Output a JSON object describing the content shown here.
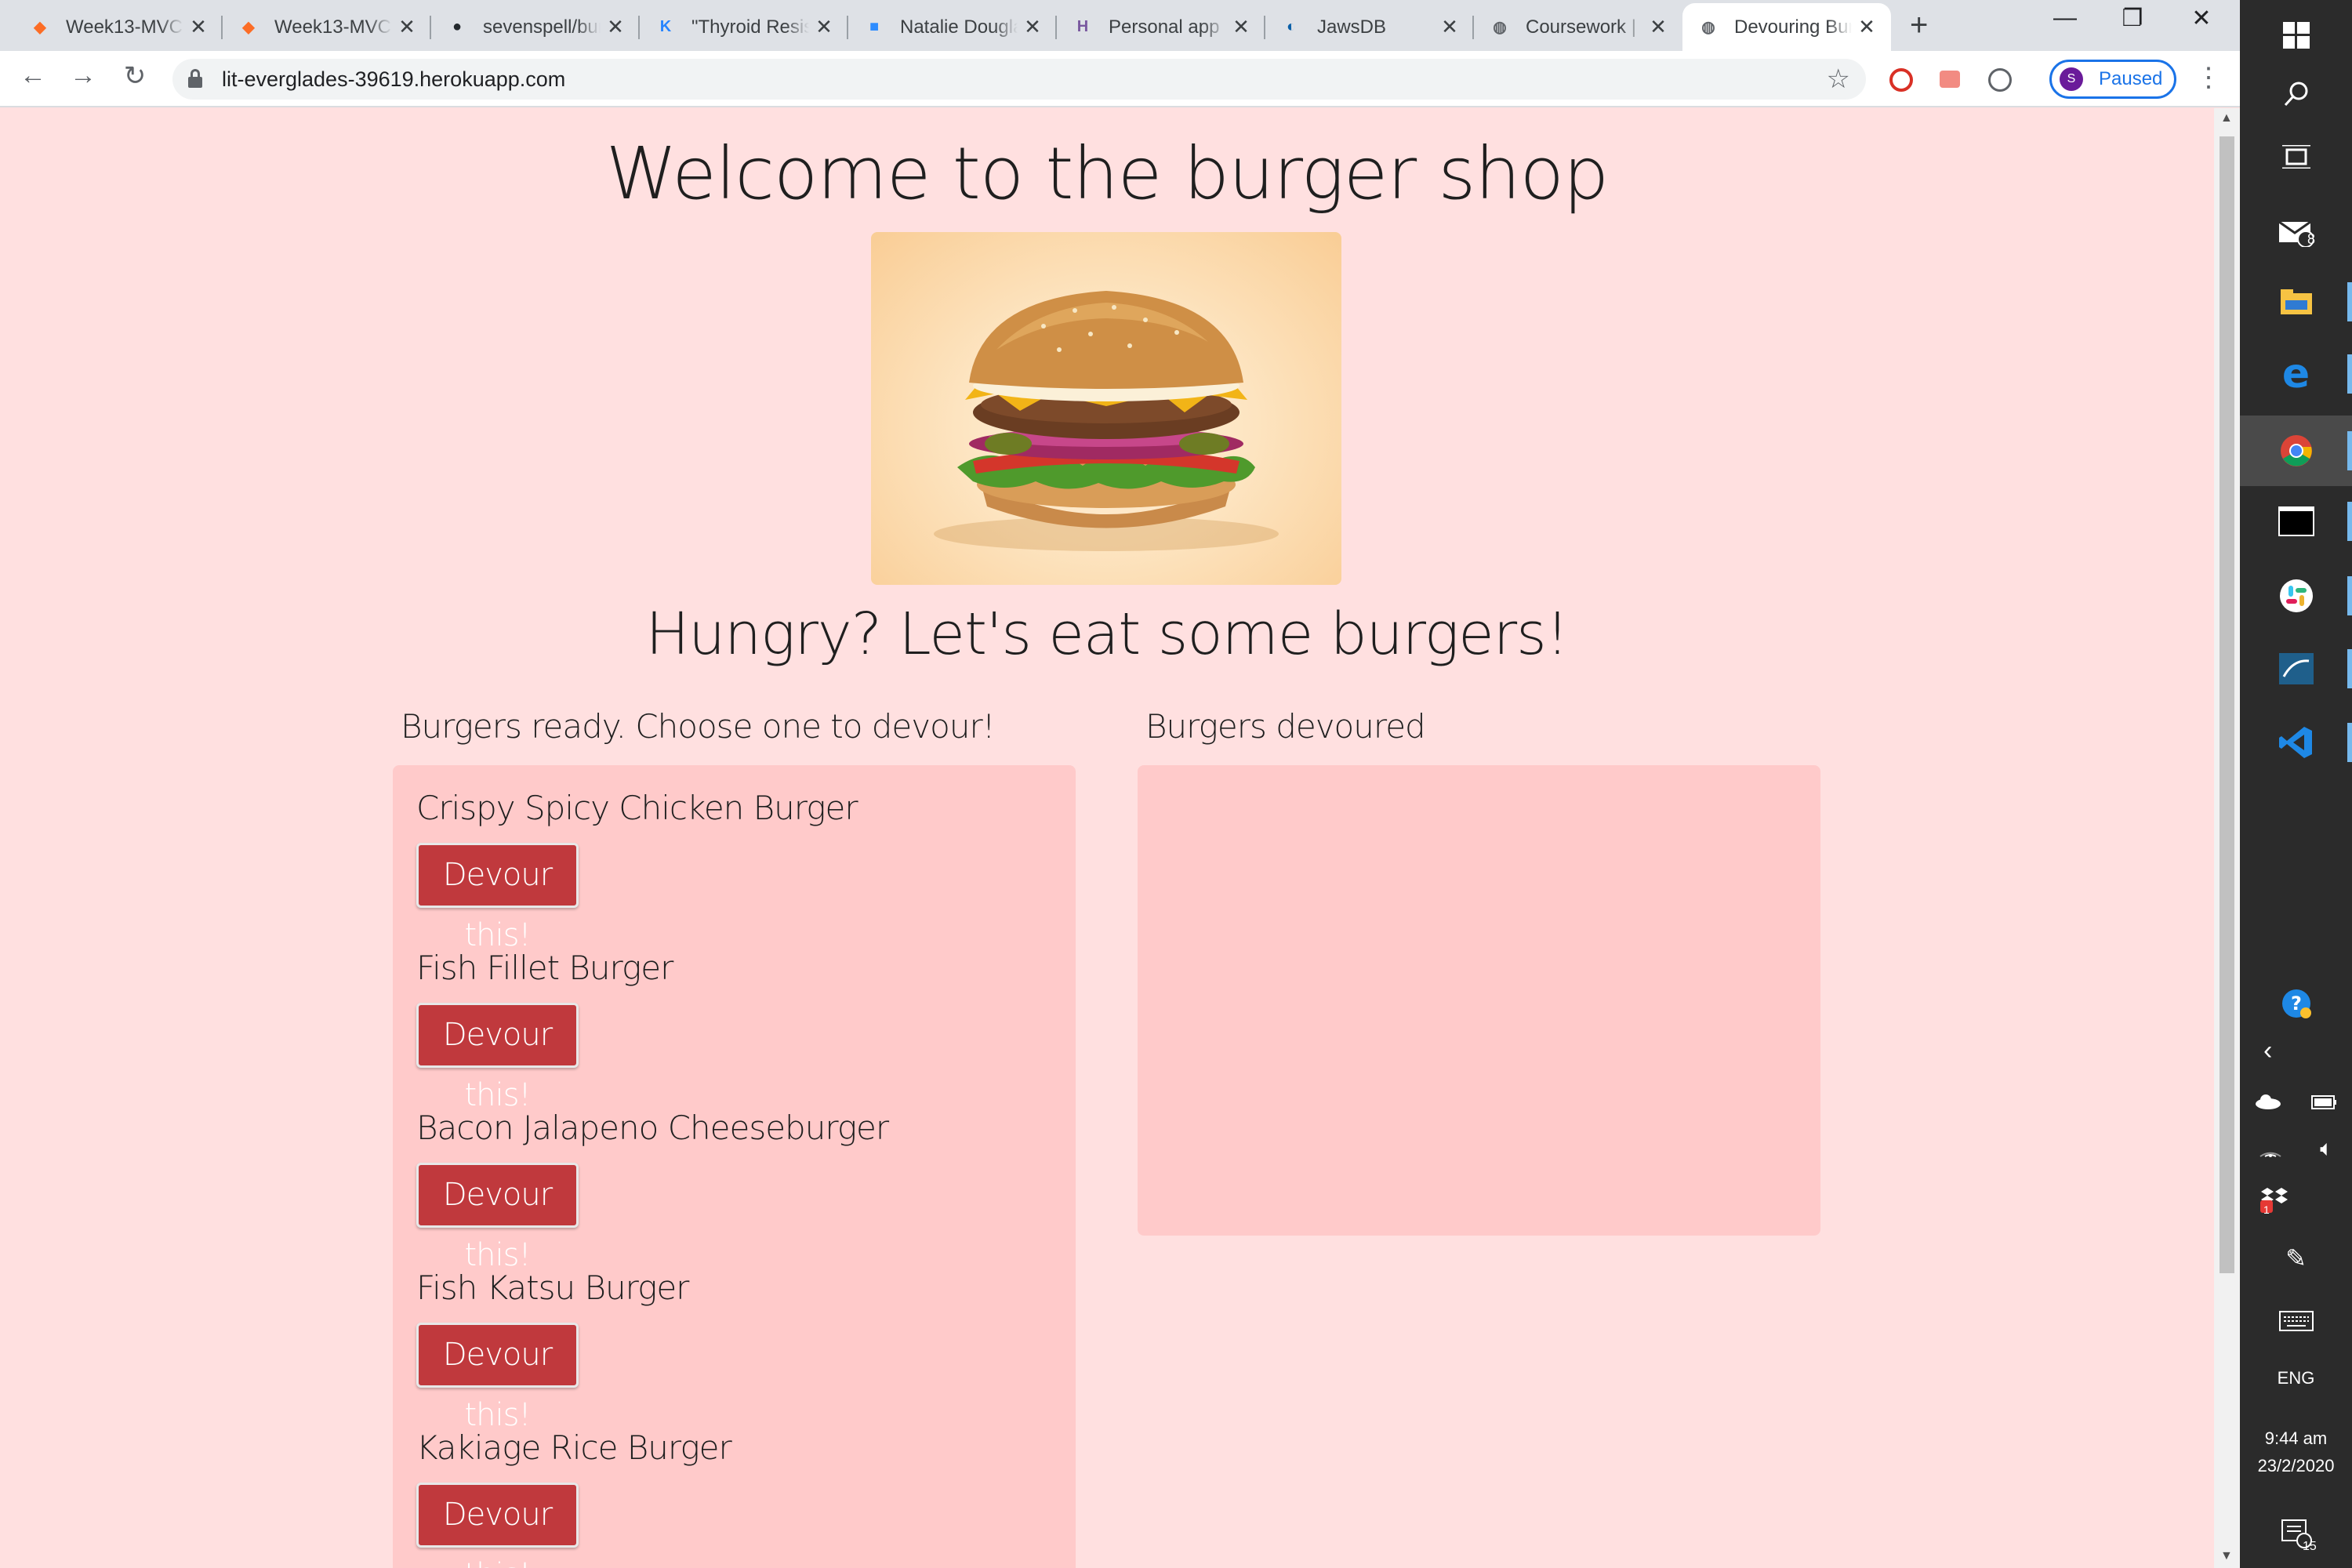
{
  "browser": {
    "tabs": [
      {
        "title": "Week13-MVC",
        "icon": "gitlab-icon",
        "color": "#fc6d26",
        "glyph": "◆"
      },
      {
        "title": "Week13-MVC",
        "icon": "gitlab-icon",
        "color": "#fc6d26",
        "glyph": "◆"
      },
      {
        "title": "sevenspell/burger",
        "icon": "github-icon",
        "color": "#24292e",
        "glyph": "●"
      },
      {
        "title": "\"Thyroid Resistance",
        "icon": "kanban-icon",
        "color": "#2684ff",
        "glyph": "K"
      },
      {
        "title": "Natalie Douglas",
        "icon": "zoom-icon",
        "color": "#2d8cff",
        "glyph": "■"
      },
      {
        "title": "Personal app",
        "icon": "heroku-icon",
        "color": "#79589f",
        "glyph": "H"
      },
      {
        "title": "JawsDB",
        "icon": "jawsdb-icon",
        "color": "#0a5fa8",
        "glyph": "◐"
      },
      {
        "title": "Coursework | ",
        "icon": "globe-icon",
        "color": "#5f6368",
        "glyph": "◍"
      },
      {
        "title": "Devouring Burgers",
        "icon": "globe-icon",
        "color": "#5f6368",
        "glyph": "◍",
        "active": true
      }
    ],
    "new_tab": "+",
    "window_controls": {
      "minimize": "—",
      "restore": "❐",
      "close": "✕"
    },
    "nav": {
      "back": "←",
      "forward": "→",
      "reload": "↻"
    },
    "url": "lit-everglades-39619.herokuapp.com",
    "bookmark_star": "☆",
    "profile": {
      "initial": "S",
      "status": "Paused",
      "accent": "#1a73e8"
    },
    "menu": "⋮"
  },
  "page": {
    "title": "Welcome to the burger shop",
    "subtitle": "Hungry? Let's eat some burgers!",
    "ready_heading": "Burgers ready. Choose one to devour!",
    "devoured_heading": "Burgers devoured",
    "devour_label": "Devour this!",
    "burgers_ready": [
      "Crispy Spicy Chicken Burger",
      "Fish Fillet Burger",
      "Bacon Jalapeno Cheeseburger",
      "Fish Katsu Burger",
      "Kakiage Rice Burger"
    ],
    "burgers_devoured": [],
    "colors": {
      "background": "#ffe0e0",
      "panel": "#ffcaca",
      "button": "#c0393d"
    }
  },
  "taskbar": {
    "language": "ENG",
    "time": "9:44 am",
    "date": "23/2/2020",
    "mail_badge": "8",
    "notifications_badge": "15",
    "dropbox_badge": "1"
  }
}
